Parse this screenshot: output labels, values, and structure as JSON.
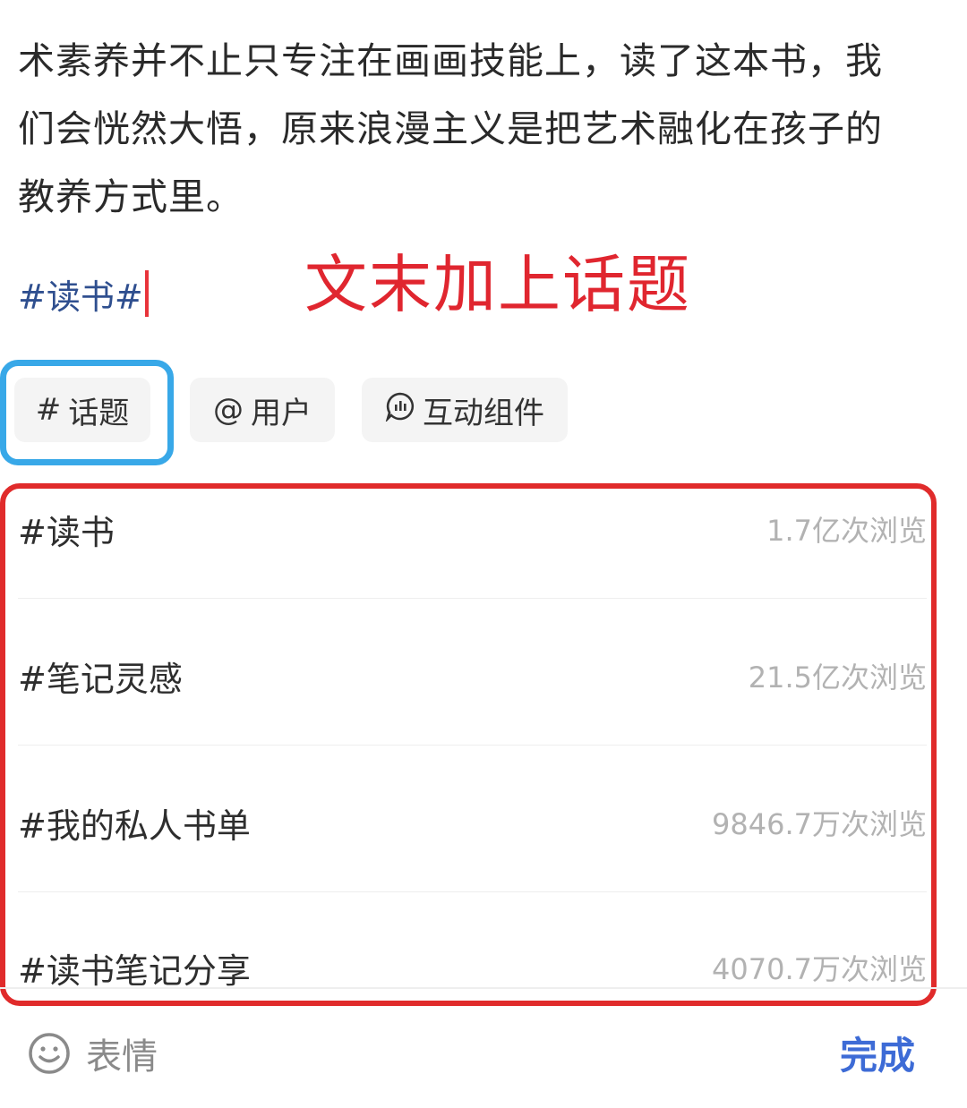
{
  "post": {
    "lines": [
      "术素养并不止只专注在画画技能上，读了这本书，我",
      "们会恍然大悟，原来浪漫主义是把艺术融化在孩子的",
      "教养方式里。"
    ],
    "topic_tag": "#读书#"
  },
  "annotation": "文末加上话题",
  "toolbar": {
    "topic_label": "话题",
    "topic_icon_glyph": "#",
    "user_label": "用户",
    "user_icon_glyph": "@",
    "widget_label": "互动组件"
  },
  "suggestions": [
    {
      "name": "#读书",
      "count": "1.7亿次浏览"
    },
    {
      "name": "#笔记灵感",
      "count": "21.5亿次浏览"
    },
    {
      "name": "#我的私人书单",
      "count": "9846.7万次浏览"
    },
    {
      "name": "#读书笔记分享",
      "count": "4070.7万次浏览"
    }
  ],
  "bottom": {
    "emoji_label": "表情",
    "done_label": "完成"
  },
  "colors": {
    "topic_link": "#2f4f8f",
    "annotation_red": "#e0262f",
    "highlight_blue": "#38a8e8",
    "done_blue": "#3d6bd6"
  }
}
